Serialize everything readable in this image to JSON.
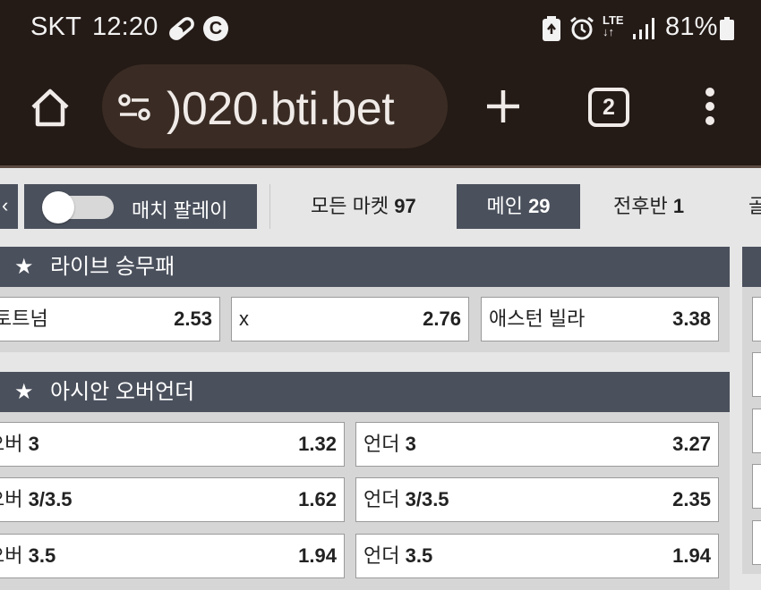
{
  "status_bar": {
    "carrier": "SKT",
    "time": "12:20",
    "left_icons": [
      "clip-icon",
      "c-badge-icon"
    ],
    "c_badge": "C",
    "right_icons": [
      "battery-saver-icon",
      "alarm-icon",
      "lte-icon",
      "signal-icon",
      "battery-icon"
    ],
    "lte_label": "LTE",
    "battery_percent": "81%"
  },
  "browser": {
    "url": ")020.bti.bet",
    "tab_count": "2",
    "icons": [
      "home-icon",
      "tune-icon",
      "plus-icon",
      "tabs-icon",
      "more-vert-icon"
    ]
  },
  "filter_bar": {
    "toggle_label": "매치 팔레이",
    "toggle_on": false,
    "tabs": [
      {
        "label": "모든 마켓",
        "count": "97",
        "active": false
      },
      {
        "label": "메인",
        "count": "29",
        "active": true
      },
      {
        "label": "전후반",
        "count": "1",
        "active": false
      },
      {
        "label": "골",
        "count": "",
        "active": false
      }
    ]
  },
  "markets": [
    {
      "title": "라이브 승무패",
      "odds": [
        {
          "name": "토트넘",
          "value": "2.53"
        },
        {
          "name": "x",
          "value": "2.76"
        },
        {
          "name": "애스턴 빌라",
          "value": "3.38"
        }
      ]
    },
    {
      "title": "아시안 오버언더",
      "rows": [
        {
          "over_prefix": "오버",
          "over_line": "3",
          "over_value": "1.32",
          "under_prefix": "언더",
          "under_line": "3",
          "under_value": "3.27"
        },
        {
          "over_prefix": "오버",
          "over_line": "3/3.5",
          "over_value": "1.62",
          "under_prefix": "언더",
          "under_line": "3/3.5",
          "under_value": "2.35"
        },
        {
          "over_prefix": "오버",
          "over_line": "3.5",
          "over_value": "1.94",
          "under_prefix": "언더",
          "under_line": "3.5",
          "under_value": "1.94"
        }
      ]
    }
  ],
  "colors": {
    "chrome_bg": "#241a16",
    "url_bar_bg": "#3a2c24",
    "header_dark": "#4a505c",
    "page_bg": "#e6e6e6",
    "odd_cell_bg": "#ffffff"
  }
}
